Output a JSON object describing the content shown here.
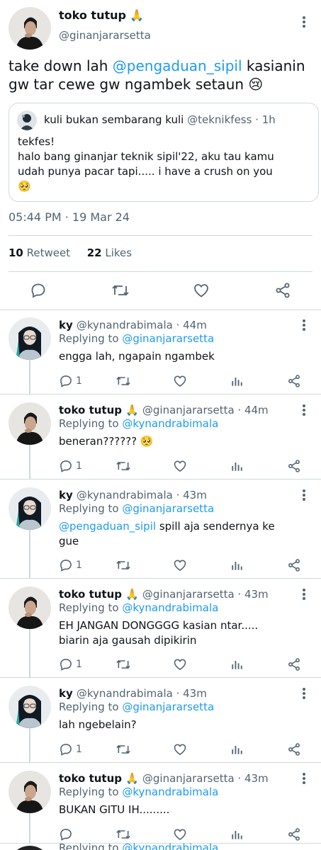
{
  "main": {
    "author_name": "toko tutup",
    "author_emoji": "🙏",
    "author_handle": "@ginanjararsetta",
    "text_before": "take down lah ",
    "mention": "@pengaduan_sipil",
    "text_after": " kasianin gw tar cewe gw ngambek setaun 😢",
    "time": "05:44 PM · 19 Mar 24",
    "retweets": "10",
    "retweets_label": "Retweet",
    "likes": "22",
    "likes_label": "Likes"
  },
  "quote": {
    "name": "kuli bukan sembarang kuli",
    "handle": "@teknikfess · 1h",
    "line1": "tekfes!",
    "line2": "halo bang ginanjar teknik sipil'22, aku tau kamu",
    "line3": "udah punya pacar tapi..... i have a crush on you",
    "line4": "🥺"
  },
  "replying_prefix": "Replying to",
  "replies": [
    {
      "name": "ky",
      "emoji": "",
      "handle": "@kynandrabimala · 44m",
      "to": "@ginanjararsetta",
      "line1": "engga lah, ngapain ngambek",
      "line2": "",
      "mention": "",
      "count": "1",
      "avatar": "girl"
    },
    {
      "name": "toko tutup",
      "emoji": "🙏",
      "handle": "@ginanjararsetta · 44m",
      "to": "@kynandrabimala",
      "line1": "beneran?????? 🥺",
      "line2": "",
      "mention": "",
      "count": "1",
      "avatar": "guy"
    },
    {
      "name": "ky",
      "emoji": "",
      "handle": "@kynandrabimala · 43m",
      "to": "@ginanjararsetta",
      "line1": " spill aja sendernya ke",
      "line2": "gue",
      "mention": "@pengaduan_sipil",
      "count": "1",
      "avatar": "girl"
    },
    {
      "name": "toko tutup",
      "emoji": "🙏",
      "handle": "@ginanjararsetta · 43m",
      "to": "@kynandrabimala",
      "line1": "EH JANGAN DONGGGG kasian ntar.....",
      "line2": "biarin aja gausah dipikirin",
      "mention": "",
      "count": "1",
      "avatar": "guy"
    },
    {
      "name": "ky",
      "emoji": "",
      "handle": "@kynandrabimala · 43m",
      "to": "@ginanjararsetta",
      "line1": "lah ngebelain?",
      "line2": "",
      "mention": "",
      "count": "1",
      "avatar": "girl"
    },
    {
      "name": "toko tutup",
      "emoji": "🙏",
      "handle": "@ginanjararsetta · 43m",
      "to": "@kynandrabimala",
      "line1": "BUKAN GITU IH.........",
      "line2": "",
      "mention": "",
      "count": "",
      "avatar": "guy"
    }
  ],
  "cut_reply": {
    "to": "@kynandrabimala"
  },
  "colors": {
    "accent": "#1d9bf0",
    "text": "#0f1419",
    "secondary": "#536471",
    "border": "#cfd9de"
  }
}
